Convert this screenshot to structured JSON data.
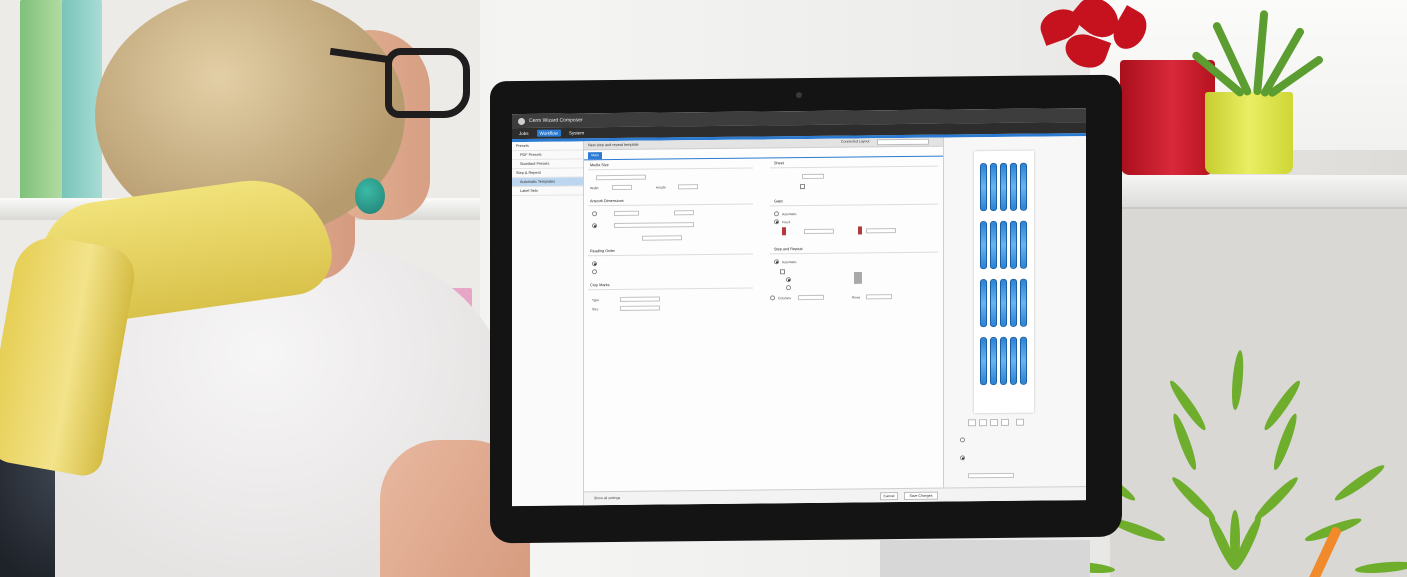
{
  "app": {
    "title": "Cerm Wizard Composer",
    "menu": [
      {
        "label": "Jobs",
        "active": false
      },
      {
        "label": "Workflow",
        "active": true
      },
      {
        "label": "System",
        "active": false
      }
    ],
    "sidebar": [
      {
        "label": "Presets",
        "indent": false,
        "selected": false
      },
      {
        "label": "PDF Presets",
        "indent": true,
        "selected": false
      },
      {
        "label": "Standard Presets",
        "indent": true,
        "selected": false
      },
      {
        "label": "Step & Repeat",
        "indent": false,
        "selected": false
      },
      {
        "label": "Automatic Templates",
        "indent": true,
        "selected": true
      },
      {
        "label": "Label Sets",
        "indent": true,
        "selected": false
      }
    ],
    "panel": {
      "header": "New step and repeat template",
      "layout_label": "Connected Layout",
      "tab_label": "Main",
      "sections": {
        "media_size": "Media Size",
        "sheet": "Sheet",
        "artwork_dimensions": "Artwork Dimensions",
        "gaps": "Gaps",
        "reading_order": "Reading Order",
        "step_repeat": "Step and Repeat",
        "crop_marks": "Crop Marks"
      },
      "labels": {
        "width": "Width",
        "height": "Height",
        "automatic": "Automatic",
        "fixed": "Fixed",
        "type": "Type",
        "size": "Size",
        "rows": "Rows",
        "columns": "Columns"
      },
      "footer_text": "Show all settings",
      "buttons": {
        "cancel": "Cancel",
        "save": "Save Changes"
      }
    },
    "preview": {
      "rows": 4,
      "columns": 5,
      "label_color": "#2a83d6"
    }
  }
}
